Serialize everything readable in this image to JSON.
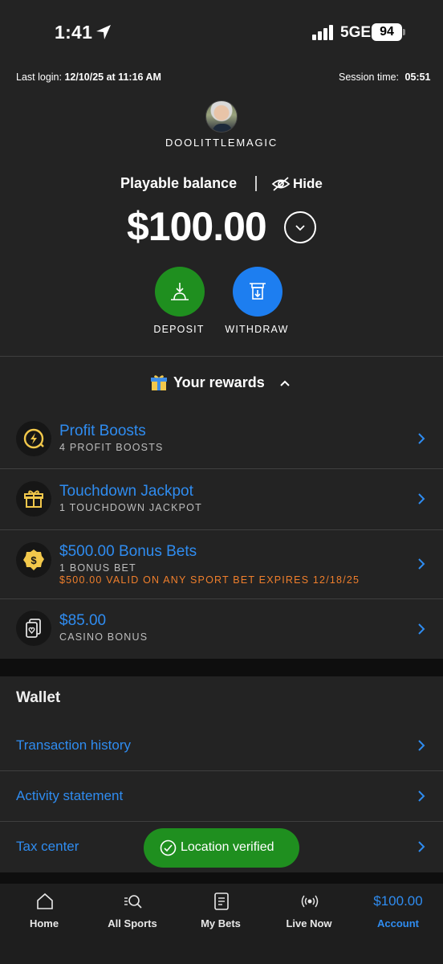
{
  "status_bar": {
    "time": "1:41",
    "network": "5GE",
    "battery": "94"
  },
  "session": {
    "last_login_label": "Last login:",
    "last_login_value": "12/10/25 at 11:16 AM",
    "session_time_label": "Session time:",
    "session_time_value": "05:51"
  },
  "user": {
    "username": "DOOLITTLEMAGIC"
  },
  "balance": {
    "label": "Playable balance",
    "hide_label": "Hide",
    "amount": "$100.00"
  },
  "actions": {
    "deposit": "DEPOSIT",
    "withdraw": "WITHDRAW"
  },
  "rewards": {
    "title": "Your rewards",
    "items": [
      {
        "title": "Profit Boosts",
        "subtitle": "4 PROFIT BOOSTS",
        "icon": "lightning-boost-icon"
      },
      {
        "title": "Touchdown Jackpot",
        "subtitle": "1 TOUCHDOWN JACKPOT",
        "icon": "gift-box-icon"
      },
      {
        "title": "$500.00 Bonus Bets",
        "subtitle": "1 BONUS BET",
        "detail": "$500.00 VALID ON ANY SPORT BET EXPIRES 12/18/25",
        "icon": "dollar-badge-icon"
      },
      {
        "title": "$85.00",
        "subtitle": "CASINO BONUS",
        "icon": "playing-cards-icon"
      }
    ]
  },
  "wallet": {
    "title": "Wallet",
    "items": [
      "Transaction history",
      "Activity statement",
      "Tax center"
    ]
  },
  "toast": {
    "text": "Location verified"
  },
  "tabs": [
    {
      "label": "Home",
      "icon": "home-icon"
    },
    {
      "label": "All Sports",
      "icon": "search-sports-icon"
    },
    {
      "label": "My Bets",
      "icon": "bet-slip-icon"
    },
    {
      "label": "Live Now",
      "icon": "live-broadcast-icon"
    },
    {
      "label": "Account",
      "amount": "$100.00",
      "active": true
    }
  ],
  "colors": {
    "accent_blue": "#2f8cf0",
    "deposit_green": "#1f8f1f",
    "withdraw_blue": "#1d7ef0",
    "expiry_orange": "#f07f2c",
    "background": "#232323"
  }
}
